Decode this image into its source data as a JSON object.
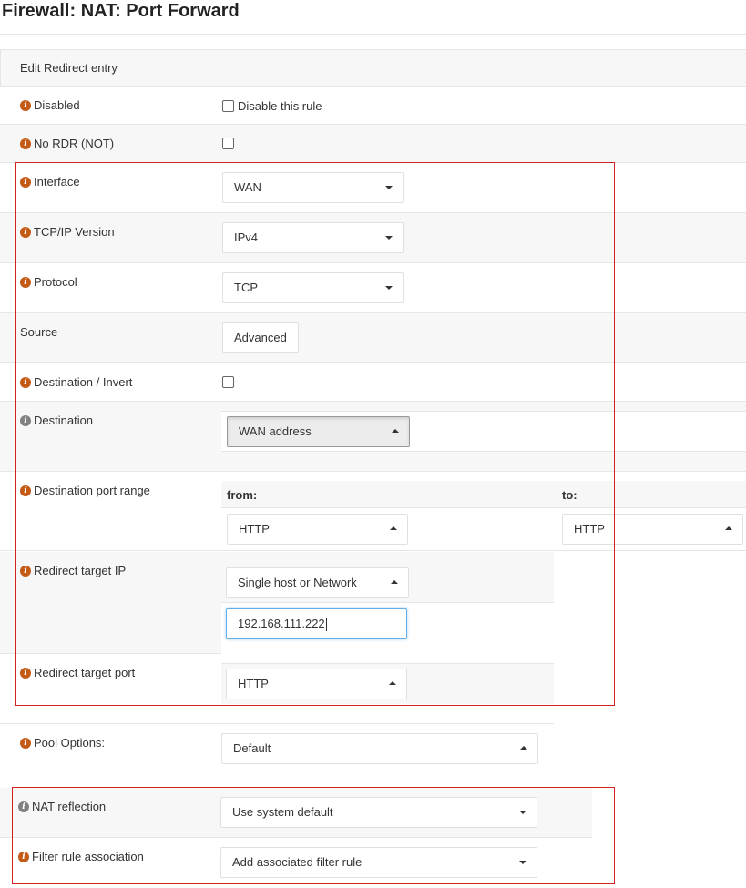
{
  "page": {
    "title": "Firewall: NAT: Port Forward"
  },
  "panel": {
    "heading": "Edit Redirect entry"
  },
  "fields": {
    "disabled": {
      "label": "Disabled",
      "checkbox_text": "Disable this rule"
    },
    "no_rdr": {
      "label": "No RDR (NOT)"
    },
    "interface": {
      "label": "Interface",
      "value": "WAN"
    },
    "tcpip_version": {
      "label": "TCP/IP Version",
      "value": "IPv4"
    },
    "protocol": {
      "label": "Protocol",
      "value": "TCP"
    },
    "source": {
      "label": "Source",
      "button": "Advanced"
    },
    "destination_invert": {
      "label": "Destination / Invert"
    },
    "destination": {
      "label": "Destination",
      "value": "WAN address"
    },
    "dest_port_range": {
      "label": "Destination port range",
      "from_label": "from:",
      "to_label": "to:",
      "from_value": "HTTP",
      "to_value": "HTTP"
    },
    "redirect_target_ip": {
      "label": "Redirect target IP",
      "type_value": "Single host or Network",
      "ip_value": "192.168.111.222"
    },
    "redirect_target_port": {
      "label": "Redirect target port",
      "value": "HTTP"
    },
    "pool_options": {
      "label": "Pool Options:",
      "value": "Default"
    },
    "nat_reflection": {
      "label": "NAT reflection",
      "value": "Use system default"
    },
    "filter_rule_association": {
      "label": "Filter rule association",
      "value": "Add associated filter rule"
    }
  },
  "colors": {
    "info_icon": "#c35a15",
    "info_icon_muted": "#808080",
    "highlight_box": "#d42020",
    "focus_border": "#66afe9"
  }
}
